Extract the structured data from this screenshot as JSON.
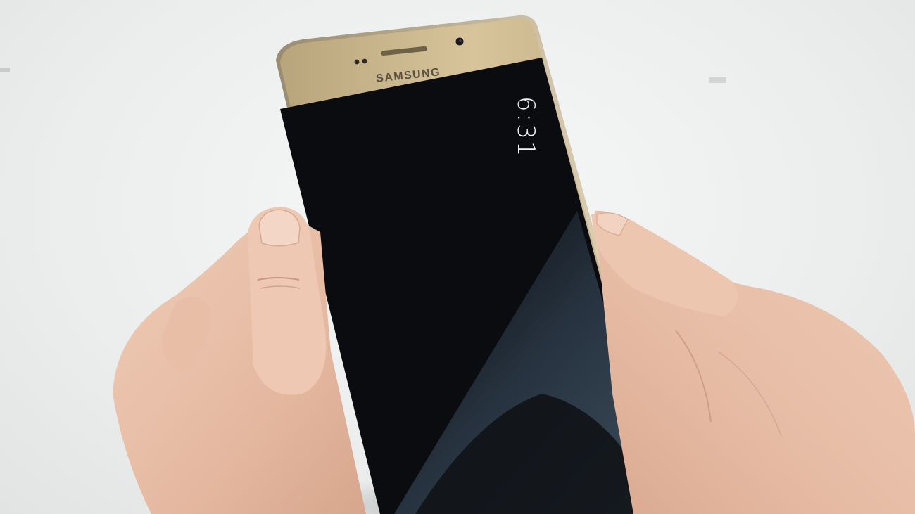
{
  "scene": {
    "background_color": "#eceeee",
    "skin_color": "#e9c3ae",
    "phone_frame_color": "#cdb88f",
    "screen_color": "#0b0c0f"
  },
  "phone": {
    "brand": "SAMSUNG",
    "always_on_display": {
      "time": "6:31"
    }
  }
}
